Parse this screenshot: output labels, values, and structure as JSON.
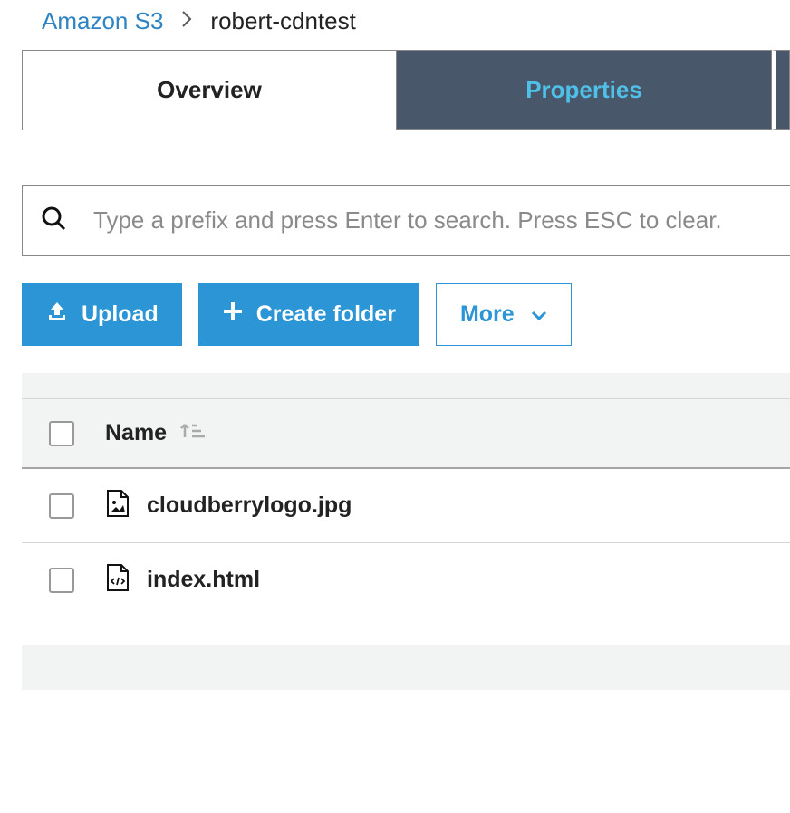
{
  "breadcrumb": {
    "root": "Amazon S3",
    "current": "robert-cdntest"
  },
  "tabs": {
    "overview": "Overview",
    "properties": "Properties"
  },
  "search": {
    "placeholder": "Type a prefix and press Enter to search. Press ESC to clear."
  },
  "toolbar": {
    "upload": "Upload",
    "create_folder": "Create folder",
    "more": "More"
  },
  "table": {
    "column_name": "Name",
    "files": [
      {
        "name": "cloudberrylogo.jpg",
        "type": "image"
      },
      {
        "name": "index.html",
        "type": "html"
      }
    ]
  }
}
